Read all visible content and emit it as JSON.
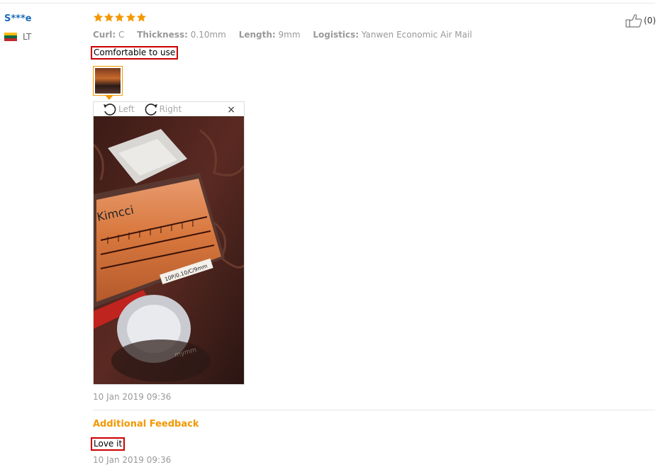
{
  "review": {
    "user_name": "S***e",
    "country_code": "LT",
    "flag_colors": [
      "#fdb913",
      "#006a44",
      "#c1272d"
    ],
    "rating": 5,
    "rating_max": 5,
    "star_color": "#f39800",
    "attributes": [
      {
        "key": "Curl:",
        "value": "C"
      },
      {
        "key": "Thickness:",
        "value": "0.10mm"
      },
      {
        "key": "Length:",
        "value": "9mm"
      },
      {
        "key": "Logistics:",
        "value": "Yanwen Economic Air Mail"
      }
    ],
    "feedback_text": "Comfortable to use",
    "helpful_count": "(0)",
    "helpful_icon": "thumbs-up-icon",
    "date": "10 Jan 2019 09:36"
  },
  "viewer": {
    "rotate_left_label": "Left",
    "rotate_right_label": "Right",
    "close_label": "×",
    "photo": {
      "brand_text": "Kimcci",
      "product_label": "10P/0.10/C/9mm"
    }
  },
  "additional": {
    "title": "Additional Feedback",
    "text": "Love it",
    "date": "10 Jan 2019 09:36"
  }
}
